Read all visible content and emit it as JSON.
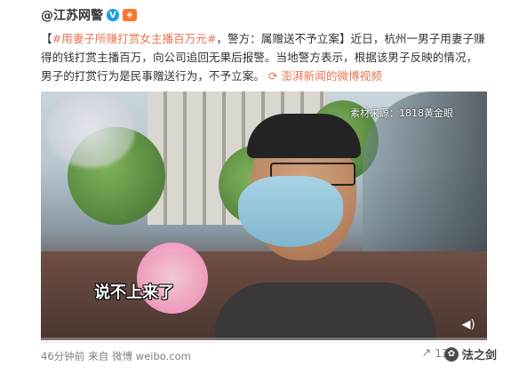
{
  "post": {
    "author": "@江苏网警",
    "verified_badge": "V",
    "member_icon": "会员",
    "text_prefix_bracket": "【",
    "hashtag": "#用妻子所赚打赏女主播百万元#",
    "text_after_hashtag": "，警方：属赠送不予立案】近日，杭州一男子用妻子赚得的钱打赏主播百万，向公司追回无果后报警。当地警方表示，根据该男子反映的情况，男子的打赏行为是民事赠送行为，不予立案。",
    "video_link_icon": "video-link-icon",
    "video_link_text": "澎湃新闻的微博视频"
  },
  "video": {
    "watermark": "素材来源：1818黄金眼",
    "subtitle": "说不上来了",
    "progress": 0.0
  },
  "footer": {
    "time": "46分钟前",
    "source_prefix": "来自",
    "source": "微博 weibo.com",
    "repost_count": "13",
    "comment_count": "",
    "like_count": ""
  },
  "brand": {
    "name": "法之剑"
  },
  "colors": {
    "accent": "#eb7350",
    "verified": "#1b9de6"
  }
}
